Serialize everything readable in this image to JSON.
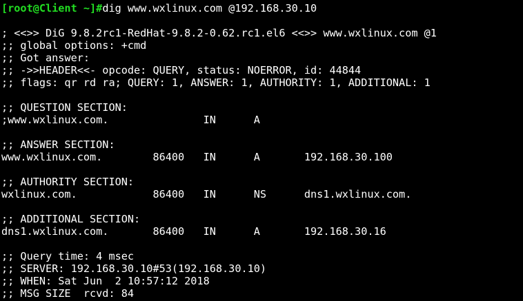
{
  "terminal": {
    "prompt": "[root@Client ~]#",
    "command": "dig www.wxlinux.com @192.168.30.10",
    "header": {
      "version_line": "; <<>> DiG 9.8.2rc1-RedHat-9.8.2-0.62.rc1.el6 <<>> www.wxlinux.com @1",
      "global_options": ";; global options: +cmd",
      "got_answer": ";; Got answer:",
      "header_line": ";; ->>HEADER<<- opcode: QUERY, status: NOERROR, id: 44844",
      "flags_line": ";; flags: qr rd ra; QUERY: 1, ANSWER: 1, AUTHORITY: 1, ADDITIONAL: 1"
    },
    "question": {
      "title": ";; QUESTION SECTION:",
      "record": ";www.wxlinux.com.               IN      A"
    },
    "answer": {
      "title": ";; ANSWER SECTION:",
      "record": "www.wxlinux.com.        86400   IN      A       192.168.30.100"
    },
    "authority": {
      "title": ";; AUTHORITY SECTION:",
      "record": "wxlinux.com.            86400   IN      NS      dns1.wxlinux.com."
    },
    "additional": {
      "title": ";; ADDITIONAL SECTION:",
      "record": "dns1.wxlinux.com.       86400   IN      A       192.168.30.16"
    },
    "stats": {
      "query_time": ";; Query time: 4 msec",
      "server": ";; SERVER: 192.168.30.10#53(192.168.30.10)",
      "when": ";; WHEN: Sat Jun  2 10:57:12 2018",
      "msg_size": ";; MSG SIZE  rcvd: 84"
    },
    "colors": {
      "background": "#000000",
      "text": "#ffffff",
      "prompt": "#22dd22"
    }
  }
}
